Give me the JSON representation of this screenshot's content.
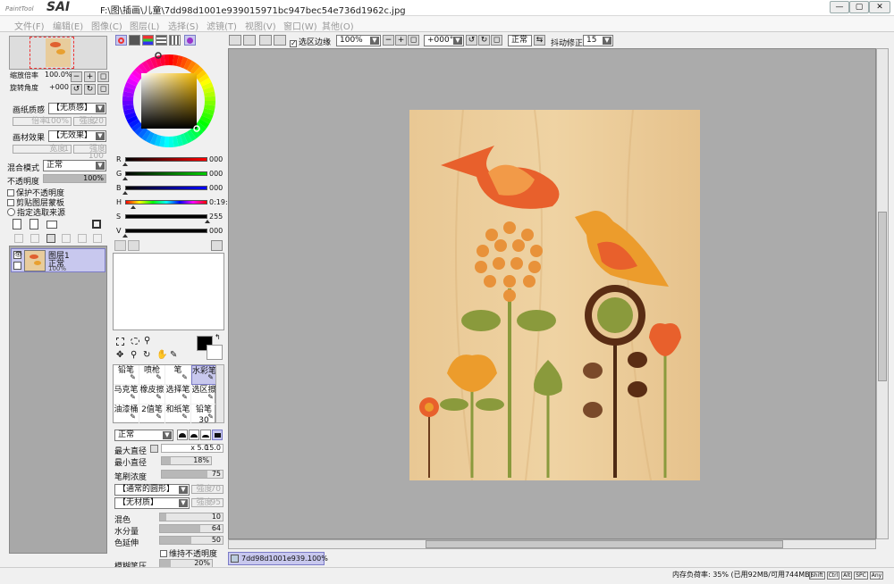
{
  "app": {
    "logo_small": "PaintTool",
    "logo_big": "SAI",
    "file_path": "F:\\图\\插画\\儿童\\7dd98d1001e939015971bc947bec54e736d1962c.jpg"
  },
  "menu": [
    "文件(F)",
    "编辑(E)",
    "图像(C)",
    "图层(L)",
    "选择(S)",
    "滤镜(T)",
    "视图(V)",
    "窗口(W)",
    "其他(O)"
  ],
  "nav": {
    "zoom_label": "缩放倍率",
    "zoom_value": "100.0%",
    "angle_label": "旋转角度",
    "angle_value": "+000"
  },
  "paper": {
    "texture_label": "画纸质感",
    "texture_value": "【无质感】",
    "scale_label": "倍率",
    "scale_value": "100%",
    "strength_label": "强度",
    "strength_value": "20",
    "effect_label": "画材效果",
    "effect_value": "【无效果】",
    "width_label": "宽度",
    "width_value": "1",
    "effect_strength_label": "强度",
    "effect_strength_value": "100"
  },
  "blend": {
    "mode_label": "混合模式",
    "mode_value": "正常",
    "opacity_label": "不透明度",
    "opacity_value": "100%",
    "opacity_pct": 100,
    "preserve_opacity": "保护不透明度",
    "clip_layer": "剪贴图层蒙板",
    "select_source": "指定选取来源"
  },
  "layer": {
    "name": "图层1",
    "mode": "正常",
    "opacity": "100%"
  },
  "color_sliders": [
    {
      "label": "R",
      "value": "000",
      "color": "#ff0000",
      "pct": 0
    },
    {
      "label": "G",
      "value": "000",
      "color": "#00cc00",
      "pct": 0
    },
    {
      "label": "B",
      "value": "000",
      "color": "#0000ff",
      "pct": 0
    },
    {
      "label": "H",
      "value": "0:19:",
      "color": "#ff00ff",
      "pct": 10
    },
    {
      "label": "S",
      "value": "255",
      "color": "#000000",
      "pct": 100
    },
    {
      "label": "V",
      "value": "000",
      "color": "#000000",
      "pct": 0
    }
  ],
  "tools": [
    {
      "label": "铅笔"
    },
    {
      "label": "喷枪"
    },
    {
      "label": "笔"
    },
    {
      "label": "水彩笔",
      "selected": true
    },
    {
      "label": "马克笔"
    },
    {
      "label": "橡皮擦"
    },
    {
      "label": "选择笔"
    },
    {
      "label": "选区擦"
    },
    {
      "label": "油漆桶"
    },
    {
      "label": "2值笔"
    },
    {
      "label": "和纸笔"
    },
    {
      "label": "铅笔30"
    }
  ],
  "brush": {
    "mode_value": "正常",
    "max_size_label": "最大直径",
    "max_size_mult": "x 5.0",
    "max_size_value": "15.0",
    "min_size_label": "最小直径",
    "min_size_value": "18%",
    "min_size_pct": 18,
    "density_label": "笔刷浓度",
    "density_value": "75",
    "density_pct": 75,
    "shape_value": "【通常的圆形】",
    "shape_strength_label": "强度",
    "shape_strength_value": "70",
    "texture_value": "【无材质】",
    "texture_strength_label": "强度",
    "texture_strength_value": "95",
    "blend_label": "混色",
    "blend_value": "10",
    "blend_pct": 10,
    "water_label": "水分量",
    "water_value": "64",
    "water_pct": 64,
    "persist_label": "色延伸",
    "persist_value": "50",
    "persist_pct": 50,
    "keep_opacity": "维持不透明度",
    "blur_label": "模糊笔压",
    "blur_value": "20%",
    "blur_pct": 20
  },
  "canvas_toolbar": {
    "antialias_label": "选区边缘",
    "zoom_value": "100%",
    "rotate_value": "+000°",
    "mode_value": "正常",
    "stabilizer_label": "抖动修正",
    "stabilizer_value": "15"
  },
  "doc_tab": {
    "name": "7dd98d1001e939...",
    "zoom": "100%"
  },
  "status": {
    "memory": "内存负荷率: 35% (已用92MB/可用744MB)",
    "keys": [
      "Shift",
      "Ctrl",
      "Alt",
      "SPC",
      "Any"
    ]
  }
}
